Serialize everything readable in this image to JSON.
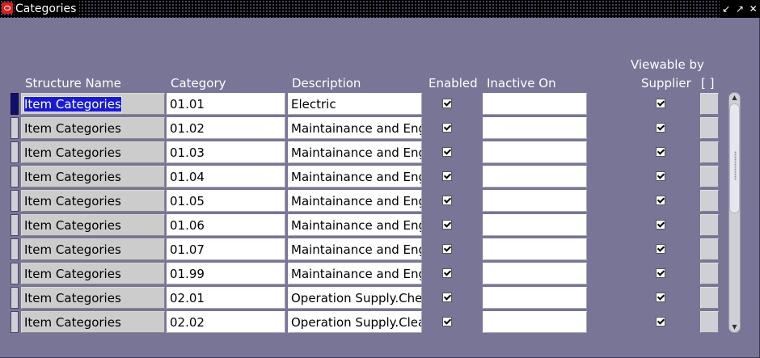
{
  "window": {
    "title": "Categories"
  },
  "headers": {
    "structure_name": "Structure Name",
    "category": "Category",
    "description": "Description",
    "enabled": "Enabled",
    "inactive_on": "Inactive On",
    "viewable_line1": "Viewable by",
    "viewable_line2": "Supplier",
    "dff": "[ ]"
  },
  "rows": [
    {
      "structure": "Item Categories",
      "category": "01.01",
      "description": "Electric",
      "enabled": true,
      "inactive_on": "",
      "viewable": true
    },
    {
      "structure": "Item Categories",
      "category": "01.02",
      "description": "Maintainance and Eng",
      "enabled": true,
      "inactive_on": "",
      "viewable": true
    },
    {
      "structure": "Item Categories",
      "category": "01.03",
      "description": "Maintainance and Eng",
      "enabled": true,
      "inactive_on": "",
      "viewable": true
    },
    {
      "structure": "Item Categories",
      "category": "01.04",
      "description": "Maintainance and Eng",
      "enabled": true,
      "inactive_on": "",
      "viewable": true
    },
    {
      "structure": "Item Categories",
      "category": "01.05",
      "description": "Maintainance and Eng",
      "enabled": true,
      "inactive_on": "",
      "viewable": true
    },
    {
      "structure": "Item Categories",
      "category": "01.06",
      "description": "Maintainance and Eng",
      "enabled": true,
      "inactive_on": "",
      "viewable": true
    },
    {
      "structure": "Item Categories",
      "category": "01.07",
      "description": "Maintainance and Eng",
      "enabled": true,
      "inactive_on": "",
      "viewable": true
    },
    {
      "structure": "Item Categories",
      "category": "01.99",
      "description": "Maintainance and Eng",
      "enabled": true,
      "inactive_on": "",
      "viewable": true
    },
    {
      "structure": "Item Categories",
      "category": "02.01",
      "description": "Operation Supply.Chei",
      "enabled": true,
      "inactive_on": "",
      "viewable": true
    },
    {
      "structure": "Item Categories",
      "category": "02.02",
      "description": "Operation Supply.Clea",
      "enabled": true,
      "inactive_on": "",
      "viewable": true
    }
  ],
  "icons": {
    "app": "oracle-logo-icon",
    "minimize": "minimize-icon",
    "restore": "restore-icon",
    "close": "close-icon"
  },
  "colors": {
    "background": "#787596",
    "selection": "#1a1ad2",
    "readonly": "#cccccc"
  }
}
